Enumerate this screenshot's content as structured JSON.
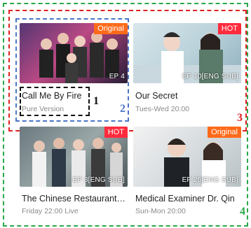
{
  "cards": [
    {
      "title": "Call Me By Fire",
      "subtitle": "Pure Version",
      "badge": "Original",
      "badge_color": "#ff6a1a",
      "episode": "EP 4"
    },
    {
      "title": "Our Secret",
      "subtitle": "Tues-Wed 20:00",
      "badge": "HOT",
      "badge_color": "#ff2b3d",
      "episode": "EP 10[ENG SUB]"
    },
    {
      "title": "The Chinese Restaurant…",
      "subtitle": "Friday 22:00 Live",
      "badge": "HOT",
      "badge_color": "#ff2b3d",
      "episode": "EP 3[ENG SUB]"
    },
    {
      "title": "Medical Examiner Dr. Qin",
      "subtitle": "Sun-Mon 20:00",
      "badge": "Original",
      "badge_color": "#ff6a1a",
      "episode": "EP 26[ENG SUB]"
    }
  ],
  "annotations": [
    {
      "label": "1",
      "color": "#111111",
      "style": "dashed"
    },
    {
      "label": "2",
      "color": "#4a76c8",
      "style": "dashed"
    },
    {
      "label": "3",
      "color": "#e02020",
      "style": "dashed"
    },
    {
      "label": "4",
      "color": "#2aa84a",
      "style": "dashed"
    }
  ]
}
